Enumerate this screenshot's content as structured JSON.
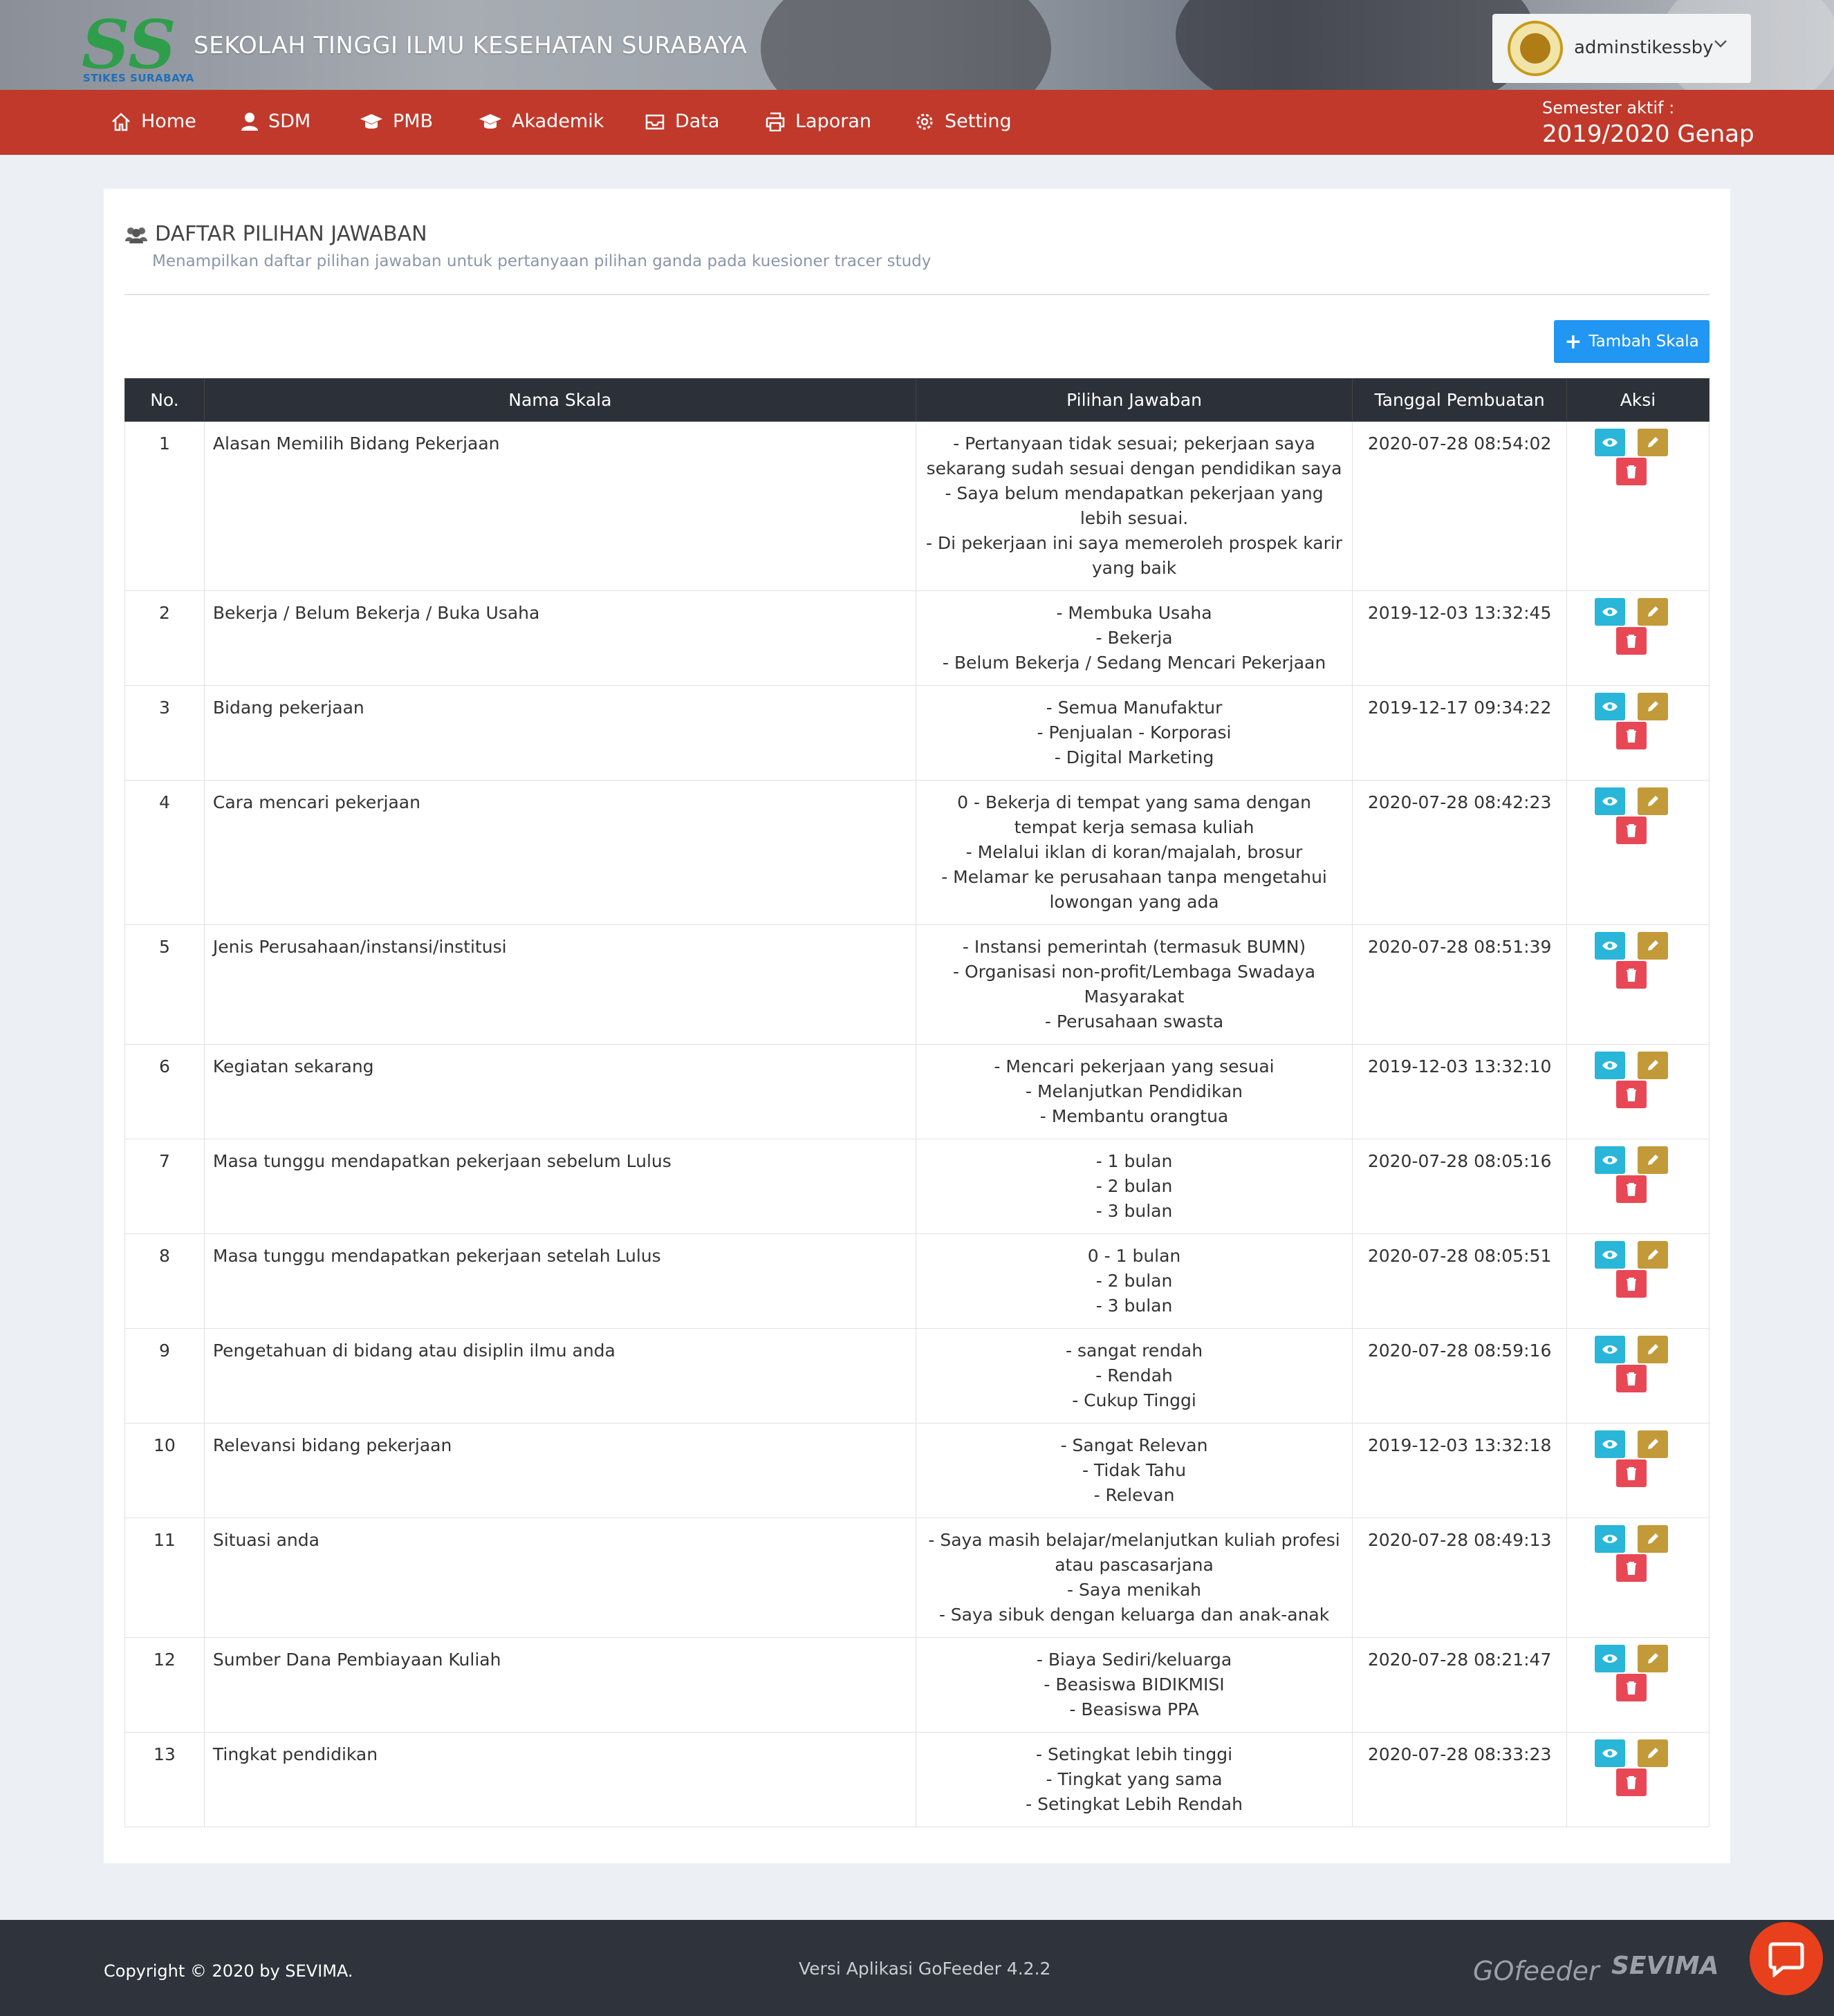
{
  "header": {
    "logo_text": "STIKES SURABAYA",
    "site_title": "SEKOLAH TINGGI ILMU KESEHATAN SURABAYA",
    "username": "adminstikessby"
  },
  "nav": {
    "items": [
      {
        "label": "Home",
        "icon": "home-icon"
      },
      {
        "label": "SDM",
        "icon": "user-icon"
      },
      {
        "label": "PMB",
        "icon": "graduation-cap-icon"
      },
      {
        "label": "Akademik",
        "icon": "graduation-cap-icon"
      },
      {
        "label": "Data",
        "icon": "inbox-icon"
      },
      {
        "label": "Laporan",
        "icon": "printer-icon"
      },
      {
        "label": "Setting",
        "icon": "gear-icon"
      }
    ],
    "semester_label": "Semester aktif :",
    "semester_value": "2019/2020 Genap"
  },
  "page": {
    "title": "DAFTAR PILIHAN JAWABAN",
    "subtitle": "Menampilkan daftar pilihan jawaban untuk pertanyaan pilihan ganda pada kuesioner tracer study",
    "add_button": "Tambah Skala"
  },
  "table": {
    "headers": [
      "No.",
      "Nama Skala",
      "Pilihan Jawaban",
      "Tanggal Pembuatan",
      "Aksi"
    ],
    "rows": [
      {
        "no": "1",
        "name": "Alasan Memilih Bidang Pekerjaan",
        "options": [
          "- Pertanyaan tidak sesuai; pekerjaan saya sekarang sudah sesuai dengan pendidikan saya",
          "- Saya belum mendapatkan pekerjaan yang lebih sesuai.",
          "- Di pekerjaan ini saya memeroleh prospek karir yang baik"
        ],
        "date": "2020-07-28 08:54:02"
      },
      {
        "no": "2",
        "name": "Bekerja / Belum Bekerja / Buka Usaha",
        "options": [
          "- Membuka Usaha",
          "- Bekerja",
          "- Belum Bekerja / Sedang Mencari Pekerjaan"
        ],
        "date": "2019-12-03 13:32:45"
      },
      {
        "no": "3",
        "name": "Bidang pekerjaan",
        "options": [
          "- Semua Manufaktur",
          "- Penjualan - Korporasi",
          "- Digital Marketing"
        ],
        "date": "2019-12-17 09:34:22"
      },
      {
        "no": "4",
        "name": "Cara mencari pekerjaan",
        "options": [
          "0 - Bekerja di tempat yang sama dengan tempat kerja semasa kuliah",
          "- Melalui iklan di koran/majalah, brosur",
          "- Melamar ke perusahaan tanpa mengetahui lowongan yang ada"
        ],
        "date": "2020-07-28 08:42:23"
      },
      {
        "no": "5",
        "name": "Jenis Perusahaan/instansi/institusi",
        "options": [
          "- Instansi pemerintah (termasuk BUMN)",
          "- Organisasi non-profit/Lembaga Swadaya Masyarakat",
          "- Perusahaan swasta"
        ],
        "date": "2020-07-28 08:51:39"
      },
      {
        "no": "6",
        "name": "Kegiatan sekarang",
        "options": [
          "- Mencari pekerjaan yang sesuai",
          "- Melanjutkan Pendidikan",
          "- Membantu orangtua"
        ],
        "date": "2019-12-03 13:32:10"
      },
      {
        "no": "7",
        "name": "Masa tunggu mendapatkan pekerjaan sebelum Lulus",
        "options": [
          "- 1 bulan",
          "- 2 bulan",
          "- 3 bulan"
        ],
        "date": "2020-07-28 08:05:16"
      },
      {
        "no": "8",
        "name": "Masa tunggu mendapatkan pekerjaan setelah Lulus",
        "options": [
          "0 - 1 bulan",
          "- 2 bulan",
          "- 3 bulan"
        ],
        "date": "2020-07-28 08:05:51"
      },
      {
        "no": "9",
        "name": "Pengetahuan di bidang atau disiplin ilmu anda",
        "options": [
          "- sangat rendah",
          "- Rendah",
          "- Cukup Tinggi"
        ],
        "date": "2020-07-28 08:59:16"
      },
      {
        "no": "10",
        "name": "Relevansi bidang pekerjaan",
        "options": [
          "- Sangat Relevan",
          "- Tidak Tahu",
          "- Relevan"
        ],
        "date": "2019-12-03 13:32:18"
      },
      {
        "no": "11",
        "name": "Situasi anda",
        "options": [
          "- Saya masih belajar/melanjutkan kuliah profesi atau pascasarjana",
          "- Saya menikah",
          "- Saya sibuk dengan keluarga dan anak-anak"
        ],
        "date": "2020-07-28 08:49:13"
      },
      {
        "no": "12",
        "name": "Sumber Dana Pembiayaan Kuliah",
        "options": [
          "- Biaya Sediri/keluarga",
          "- Beasiswa BIDIKMISI",
          "- Beasiswa PPA"
        ],
        "date": "2020-07-28 08:21:47"
      },
      {
        "no": "13",
        "name": "Tingkat pendidikan",
        "options": [
          "- Setingkat lebih tinggi",
          "- Tingkat yang sama",
          "- Setingkat Lebih Rendah"
        ],
        "date": "2020-07-28 08:33:23"
      }
    ]
  },
  "footer": {
    "copyright": "Copyright © 2020 by SEVIMA.",
    "version": "Versi Aplikasi GoFeeder 4.2.2",
    "brand_gofeeder": "GOfeeder",
    "brand_sevima": "SEVIMA"
  },
  "colors": {
    "navbar": "#c0392b",
    "table_header": "#2c3039",
    "add_button": "#2196f3",
    "view_button": "#29b6d8",
    "edit_button": "#c29a3a",
    "delete_button": "#e84855",
    "footer": "#2f333b"
  }
}
